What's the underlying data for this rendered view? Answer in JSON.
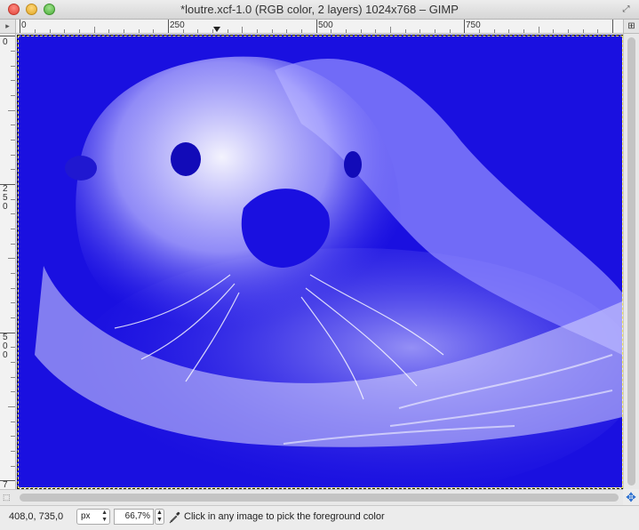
{
  "window": {
    "title": "*loutre.xcf-1.0 (RGB color, 2 layers) 1024x768 – GIMP"
  },
  "rulers": {
    "horizontal_ticks": [
      "0",
      "250",
      "500",
      "750"
    ],
    "vertical_ticks": [
      "0",
      "250",
      "500",
      "7"
    ]
  },
  "icons": {
    "navigate": "navigate-icon",
    "move": "move-icon",
    "quick_mask": "quick-mask-icon",
    "color_picker": "color-picker-icon"
  },
  "canvas": {
    "image_description": "sea otter photo",
    "tint_color": "#1a10e0"
  },
  "status": {
    "pointer_coords": "408,0, 735,0",
    "unit": "px",
    "zoom": "66,7%",
    "hint": "Click in any image to pick the foreground color"
  },
  "colors": {
    "chrome": "#ececec",
    "image_blue": "#1a10e0",
    "selection_yellow": "#f5e65a"
  }
}
